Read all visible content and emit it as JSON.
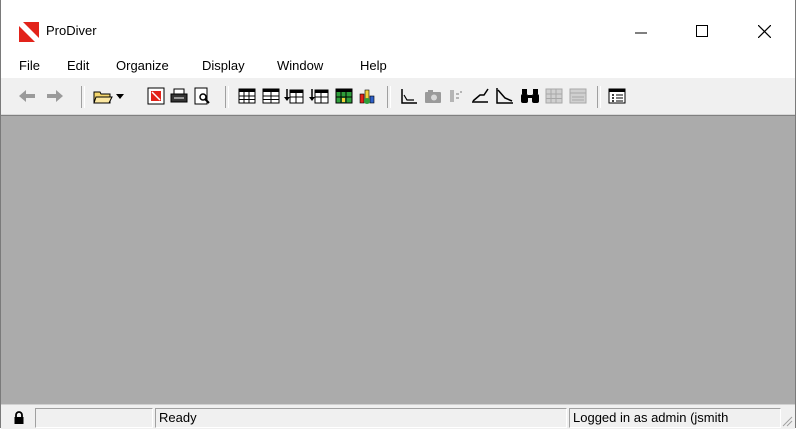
{
  "window": {
    "title": "ProDiver",
    "logo_icon": "prodiver-logo-icon",
    "colors": {
      "client_area": "#ababab",
      "logo_red": "#e2231a"
    }
  },
  "menubar": {
    "items": [
      "File",
      "Edit",
      "Organize",
      "Display",
      "Window",
      "Help"
    ]
  },
  "toolbar": {
    "buttons": [
      "back-arrow-icon",
      "forward-arrow-icon",
      "open-folder-icon",
      "dropdown-arrow-icon",
      "red-form-icon",
      "print-icon",
      "print-preview-icon",
      "table-icon",
      "table-alt-icon",
      "insert-row-icon",
      "insert-row-alt-icon",
      "grid-green-icon",
      "chart-3d-icon",
      "profile-graph-icon",
      "camera-icon",
      "filter-icon",
      "ascent-graph-icon",
      "descent-graph-icon",
      "binoculars-icon",
      "grid-disabled-icon",
      "panel-disabled-icon",
      "properties-list-icon"
    ]
  },
  "statusbar": {
    "lock_icon": "lock-icon",
    "status_text": "Ready",
    "user_text": "Logged in as admin (jsmith"
  }
}
